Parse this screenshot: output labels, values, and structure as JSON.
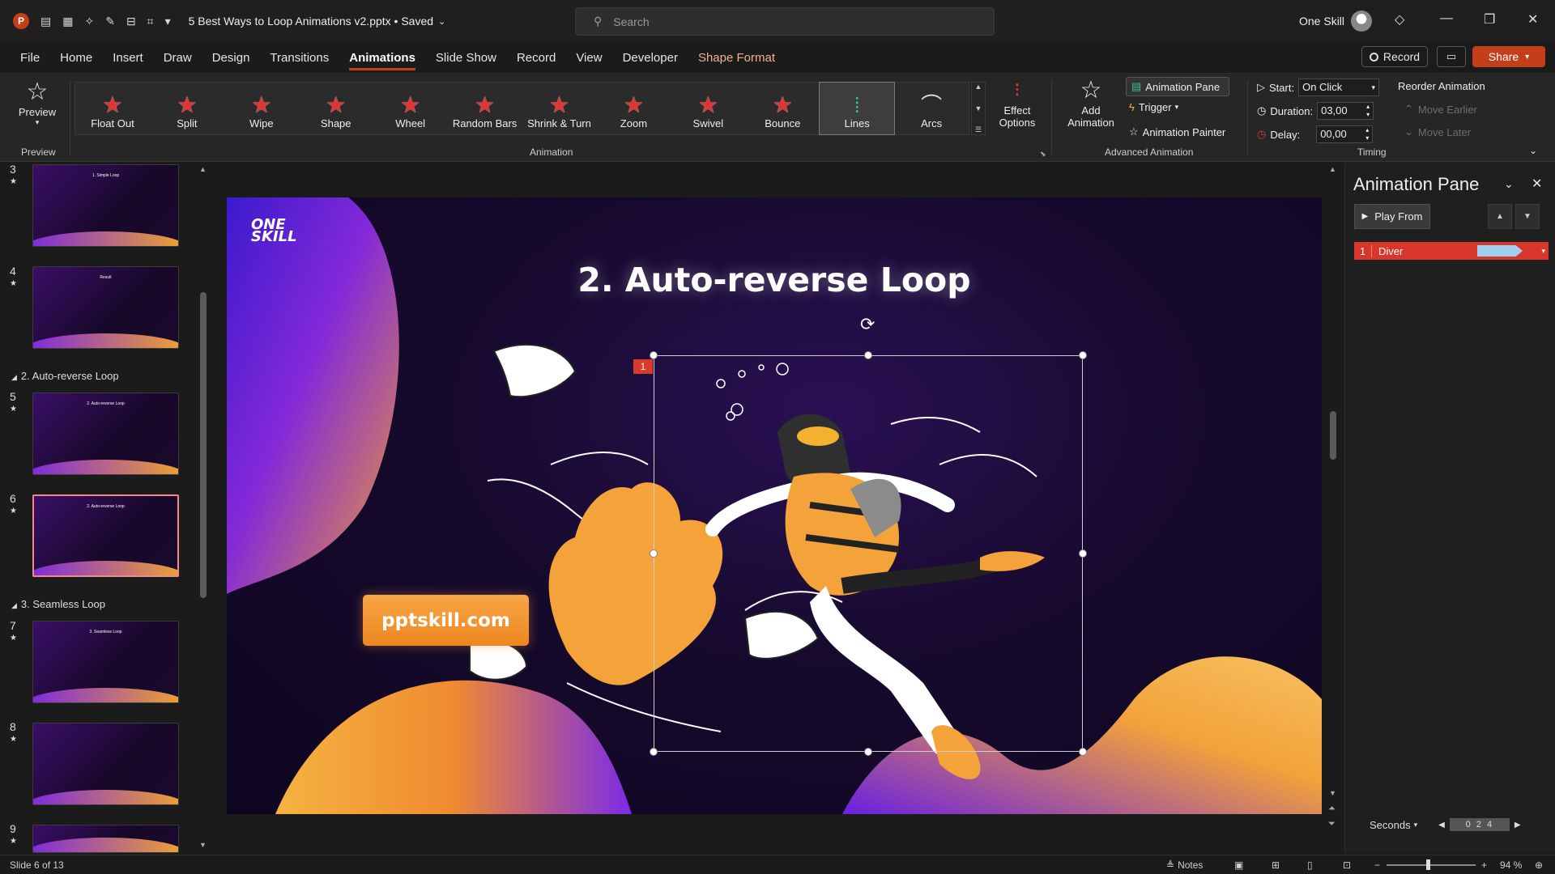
{
  "window": {
    "app_logo": "P",
    "doc_title": "5 Best Ways to Loop Animations v2.pptx • Saved",
    "search_placeholder": "Search",
    "user_name": "One Skill"
  },
  "menu": {
    "items": [
      "File",
      "Home",
      "Insert",
      "Draw",
      "Design",
      "Transitions",
      "Animations",
      "Slide Show",
      "Record",
      "View",
      "Developer",
      "Shape Format"
    ],
    "active": "Animations",
    "record_label": "Record",
    "share_label": "Share"
  },
  "ribbon": {
    "preview_label": "Preview",
    "preview_group": "Preview",
    "animation_group": "Animation",
    "gallery": [
      "Float Out",
      "Split",
      "Wipe",
      "Shape",
      "Wheel",
      "Random Bars",
      "Shrink & Turn",
      "Zoom",
      "Swivel",
      "Bounce",
      "Lines",
      "Arcs"
    ],
    "gallery_selected": "Lines",
    "effect_options": "Effect Options",
    "add_animation": "Add Animation",
    "animation_pane": "Animation Pane",
    "trigger": "Trigger",
    "animation_painter": "Animation Painter",
    "advanced_group": "Advanced Animation",
    "start_label": "Start:",
    "start_value": "On Click",
    "duration_label": "Duration:",
    "duration_value": "03,00",
    "delay_label": "Delay:",
    "delay_value": "00,00",
    "timing_group": "Timing",
    "reorder_label": "Reorder Animation",
    "move_earlier": "Move Earlier",
    "move_later": "Move Later"
  },
  "thumbnails": {
    "slides": [
      {
        "num": "3",
        "title": "1. Simple Loop"
      },
      {
        "num": "4",
        "title": "Result"
      },
      {
        "num": "5",
        "title": "2. Auto-reverse Loop"
      },
      {
        "num": "6",
        "title": "2. Auto-reverse Loop"
      },
      {
        "num": "7",
        "title": "3. Seamless Loop"
      },
      {
        "num": "8",
        "title": ""
      },
      {
        "num": "9",
        "title": ""
      }
    ],
    "sections": [
      "2. Auto-reverse Loop",
      "3. Seamless Loop"
    ]
  },
  "slide": {
    "logo_line1": "ONE",
    "logo_line2": "SKILL",
    "title": "2. Auto-reverse Loop",
    "cta": "pptskill.com",
    "anim_tag": "1"
  },
  "animation_pane": {
    "title": "Animation Pane",
    "play_from": "Play From",
    "items": [
      {
        "num": "1",
        "name": "Diver"
      }
    ],
    "timeline_unit": "Seconds",
    "timeline_ticks": "0  2  4"
  },
  "status": {
    "slide_info": "Slide 6 of 13",
    "notes": "Notes",
    "zoom": "94 %"
  },
  "colors": {
    "accent": "#c43e1c",
    "anim_item": "#d8362a",
    "slide_bg": "#160a2c",
    "cta": "#f39a36"
  }
}
